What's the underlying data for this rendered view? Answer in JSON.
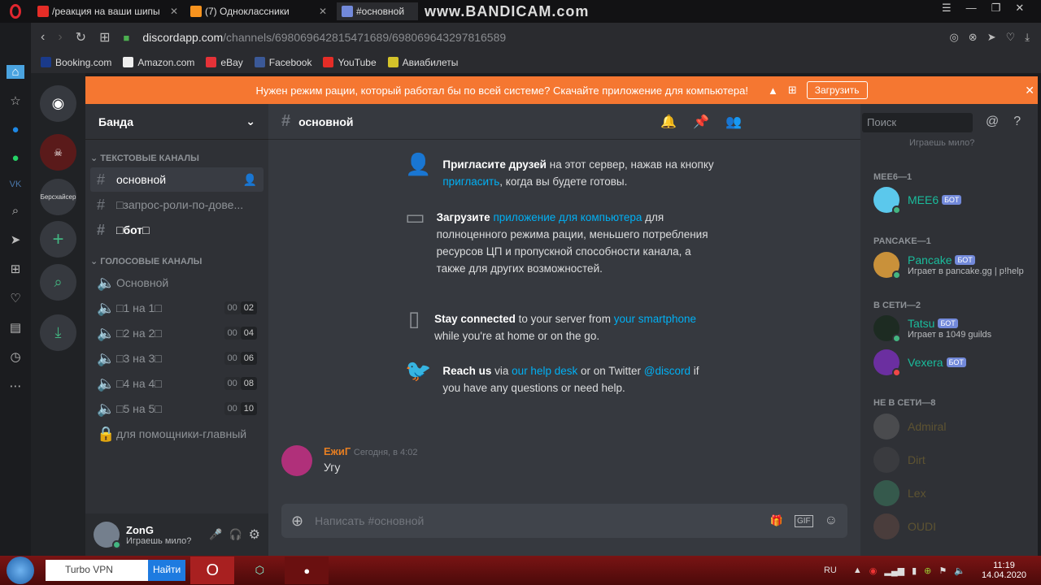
{
  "browser": {
    "tabs": [
      {
        "title": "/реакция на ваши шипы",
        "icon": "youtube-icon"
      },
      {
        "title": "(7) Одноклассники",
        "icon": "ok-icon"
      },
      {
        "title": "#основной",
        "icon": "discord-icon"
      }
    ],
    "watermark": "www.BANDICAM.com",
    "url_host": "discordapp.com",
    "url_path": "/channels/698069642815471689/698069643297816589",
    "bookmarks": [
      "Booking.com",
      "Amazon.com",
      "eBay",
      "Facebook",
      "YouTube",
      "Авиабилеты"
    ]
  },
  "banner": {
    "text": "Нужен режим рации, который работал бы по всей системе? Скачайте приложение для компьютера!",
    "button": "Загрузить",
    "color": "#f57731"
  },
  "servers": [
    {
      "label": "Берсхайсер"
    }
  ],
  "guild": {
    "name": "Банда"
  },
  "categories": {
    "text": "ТЕКСТОВЫЕ КАНАЛЫ",
    "voice": "ГОЛОСОВЫЕ КАНАЛЫ"
  },
  "text_channels": [
    "основной",
    "□запрос-роли-по-дове...",
    "□бот□"
  ],
  "voice_channels": [
    {
      "name": "Основной"
    },
    {
      "name": "□1 на 1□",
      "a": "00",
      "b": "02"
    },
    {
      "name": "□2 на 2□",
      "a": "00",
      "b": "04"
    },
    {
      "name": "□3 на 3□",
      "a": "00",
      "b": "06"
    },
    {
      "name": "□4 на 4□",
      "a": "00",
      "b": "08"
    },
    {
      "name": "□5 на 5□",
      "a": "00",
      "b": "10"
    }
  ],
  "locked_channel": "для помощники-главный",
  "user": {
    "name": "ZonG",
    "status": "Играешь мило?"
  },
  "chat": {
    "channel": "основной",
    "search_placeholder": "Поиск",
    "tips": [
      {
        "pre": "Пригласите друзей",
        "mid": " на этот сервер, нажав на кнопку ",
        "link": "пригласить",
        "post": ", когда вы будете готовы."
      },
      {
        "pre": "Загрузите ",
        "link": "приложение для компьютера",
        "post": " для полноценного режима рации, меньшего потребления ресурсов ЦП и пропускной способности канала, а также для других возможностей."
      },
      {
        "pre": "Stay connected",
        "mid": " to your server from ",
        "link": "your smartphone",
        "post": " while you're at home or on the go."
      },
      {
        "pre": "Reach us",
        "mid": " via ",
        "link": "our help desk",
        "mid2": " or on Twitter ",
        "link2": "@discord",
        "post": " if you have any questions or need help."
      }
    ],
    "message": {
      "author": "ЕжиГ",
      "time": "Сегодня, в 4:02",
      "text": "Угу",
      "author_color": "#e67e22"
    },
    "composer_placeholder": "Написать #основной"
  },
  "members": {
    "top_status": "Играешь мило?",
    "groups": [
      {
        "title": "MEE6—1",
        "members": [
          {
            "name": "MEE6",
            "bot": "БОТ",
            "verified": true
          }
        ]
      },
      {
        "title": "PANCAKE—1",
        "members": [
          {
            "name": "Pancake",
            "bot": "БОТ",
            "activity": "Играет в pancake.gg | p!help"
          }
        ]
      },
      {
        "title": "В СЕТИ—2",
        "members": [
          {
            "name": "Tatsu",
            "bot": "БОТ",
            "verified": true,
            "activity": "Играет в 1049 guilds"
          },
          {
            "name": "Vexera",
            "bot": "БОТ"
          }
        ]
      },
      {
        "title": "НЕ В СЕТИ—8",
        "members": [
          {
            "name": "Admiral"
          },
          {
            "name": "Dirt"
          },
          {
            "name": "Lex"
          },
          {
            "name": "OUDI"
          }
        ]
      }
    ]
  },
  "taskbar": {
    "search": "Turbo VPN",
    "search_button": "Найти",
    "lang": "RU",
    "time": "11:19",
    "date": "14.04.2020"
  }
}
